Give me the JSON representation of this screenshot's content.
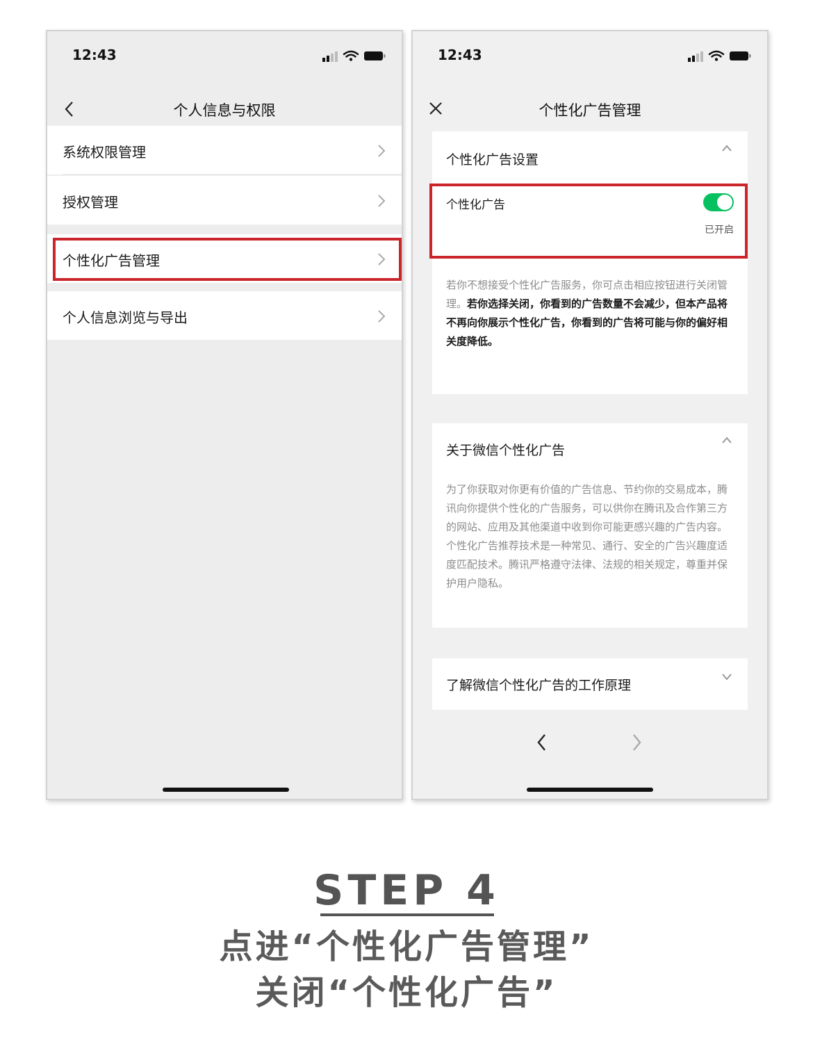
{
  "left_screen": {
    "status_time": "12:43",
    "nav_title": "个人信息与权限",
    "items": [
      {
        "label": "系统权限管理"
      },
      {
        "label": "授权管理"
      },
      {
        "label": "个性化广告管理",
        "highlighted": true
      },
      {
        "label": "个人信息浏览与导出"
      }
    ]
  },
  "right_screen": {
    "status_time": "12:43",
    "nav_title": "个性化广告管理",
    "settings_card": {
      "title": "个性化广告设置",
      "toggle_label": "个性化广告",
      "toggle_on": true,
      "toggle_state_text": "已开启",
      "desc_normal": "若你不想接受个性化广告服务，你可点击相应按钮进行关闭管理。",
      "desc_bold": "若你选择关闭，你看到的广告数量不会减少，但本产品将不再向你展示个性化广告，你看到的广告将可能与你的偏好相关度降低。"
    },
    "about_card": {
      "title": "关于微信个性化广告",
      "text": "为了你获取对你更有价值的广告信息、节约你的交易成本，腾讯向你提供个性化的广告服务，可以供你在腾讯及合作第三方的网站、应用及其他渠道中收到你可能更感兴趣的广告内容。个性化广告推荐技术是一种常见、通行、安全的广告兴趣度适度匹配技术。腾讯严格遵守法律、法规的相关规定，尊重并保护用户隐私。"
    },
    "principle_card": {
      "title": "了解微信个性化广告的工作原理"
    }
  },
  "caption": {
    "step": "STEP 4",
    "line1": "点进“个性化广告管理”",
    "line2": "关闭“个性化广告”"
  },
  "colors": {
    "highlight_red": "#c9252b",
    "switch_green": "#07c160",
    "caption_gray": "#545454"
  },
  "icons": {
    "back": "chevron-left-icon",
    "close": "close-icon",
    "row_arrow": "chevron-right-icon",
    "collapse": "chevron-up-icon",
    "expand": "chevron-down-icon"
  }
}
